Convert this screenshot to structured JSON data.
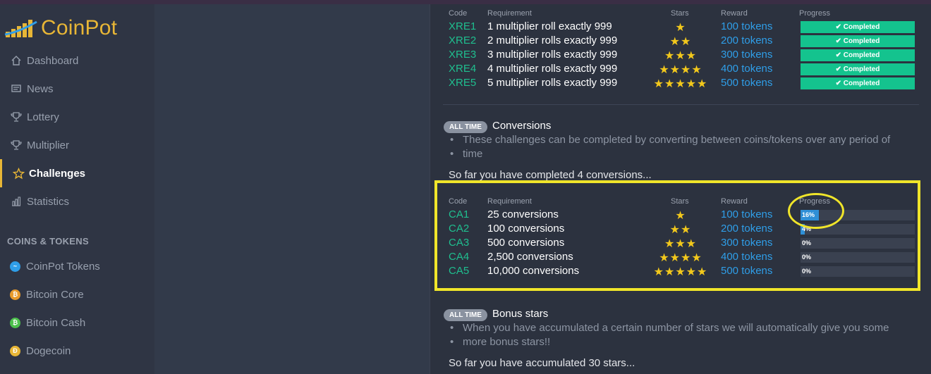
{
  "app": {
    "name": "CoinPot"
  },
  "sidebar": {
    "nav": [
      {
        "label": "Dashboard",
        "icon": "home-icon"
      },
      {
        "label": "News",
        "icon": "news-icon"
      },
      {
        "label": "Lottery",
        "icon": "trophy-icon"
      },
      {
        "label": "Multiplier",
        "icon": "trophy-icon"
      },
      {
        "label": "Challenges",
        "icon": "star-icon",
        "active": true
      },
      {
        "label": "Statistics",
        "icon": "chart-icon"
      }
    ],
    "section_title": "COINS & TOKENS",
    "coins": [
      {
        "label": "CoinPot Tokens",
        "color": "#2f9ee8"
      },
      {
        "label": "Bitcoin Core",
        "color": "#e89a2c"
      },
      {
        "label": "Bitcoin Cash",
        "color": "#4cc04c"
      },
      {
        "label": "Dogecoin",
        "color": "#e8b636"
      }
    ]
  },
  "columns": {
    "code": "Code",
    "requirement": "Requirement",
    "stars": "Stars",
    "reward": "Reward",
    "progress": "Progress"
  },
  "multiplier_table": {
    "rows": [
      {
        "code": "XRE1",
        "requirement": "1 multiplier roll exactly 999",
        "stars": "★",
        "reward": "100 tokens",
        "progress": "✔ Completed"
      },
      {
        "code": "XRE2",
        "requirement": "2 multiplier rolls exactly 999",
        "stars": "★★",
        "reward": "200 tokens",
        "progress": "✔ Completed"
      },
      {
        "code": "XRE3",
        "requirement": "3 multiplier rolls exactly 999",
        "stars": "★★★",
        "reward": "300 tokens",
        "progress": "✔ Completed"
      },
      {
        "code": "XRE4",
        "requirement": "4 multiplier rolls exactly 999",
        "stars": "★★★★",
        "reward": "400 tokens",
        "progress": "✔ Completed"
      },
      {
        "code": "XRE5",
        "requirement": "5 multiplier rolls exactly 999",
        "stars": "★★★★★",
        "reward": "500 tokens",
        "progress": "✔ Completed"
      }
    ]
  },
  "conversions": {
    "badge": "ALL TIME",
    "title": "Conversions",
    "bullet_line1": "These challenges can be completed by converting between coins/tokens over any period of",
    "bullet_line2": "time",
    "so_far": "So far you have completed 4 conversions...",
    "rows": [
      {
        "code": "CA1",
        "requirement": "25 conversions",
        "stars": "★",
        "reward": "100 tokens",
        "progress_label": "16%",
        "progress": 0.16
      },
      {
        "code": "CA2",
        "requirement": "100 conversions",
        "stars": "★★",
        "reward": "200 tokens",
        "progress_label": "4%",
        "progress": 0.04
      },
      {
        "code": "CA3",
        "requirement": "500 conversions",
        "stars": "★★★",
        "reward": "300 tokens",
        "progress_label": "0%",
        "progress": 0
      },
      {
        "code": "CA4",
        "requirement": "2,500 conversions",
        "stars": "★★★★",
        "reward": "400 tokens",
        "progress_label": "0%",
        "progress": 0
      },
      {
        "code": "CA5",
        "requirement": "10,000 conversions",
        "stars": "★★★★★",
        "reward": "500 tokens",
        "progress_label": "0%",
        "progress": 0
      }
    ]
  },
  "bonus": {
    "badge": "ALL TIME",
    "title": "Bonus stars",
    "bullet_line1": "When you have accumulated a certain number of stars we will automatically give you some",
    "bullet_line2": "more bonus stars!!",
    "so_far": "So far you have accumulated 30 stars..."
  },
  "colors": {
    "accent": "#e8b636",
    "code": "#1fbf8f",
    "reward": "#2f9ee8",
    "completed": "#14c38e",
    "highlight": "#f0e52a"
  }
}
